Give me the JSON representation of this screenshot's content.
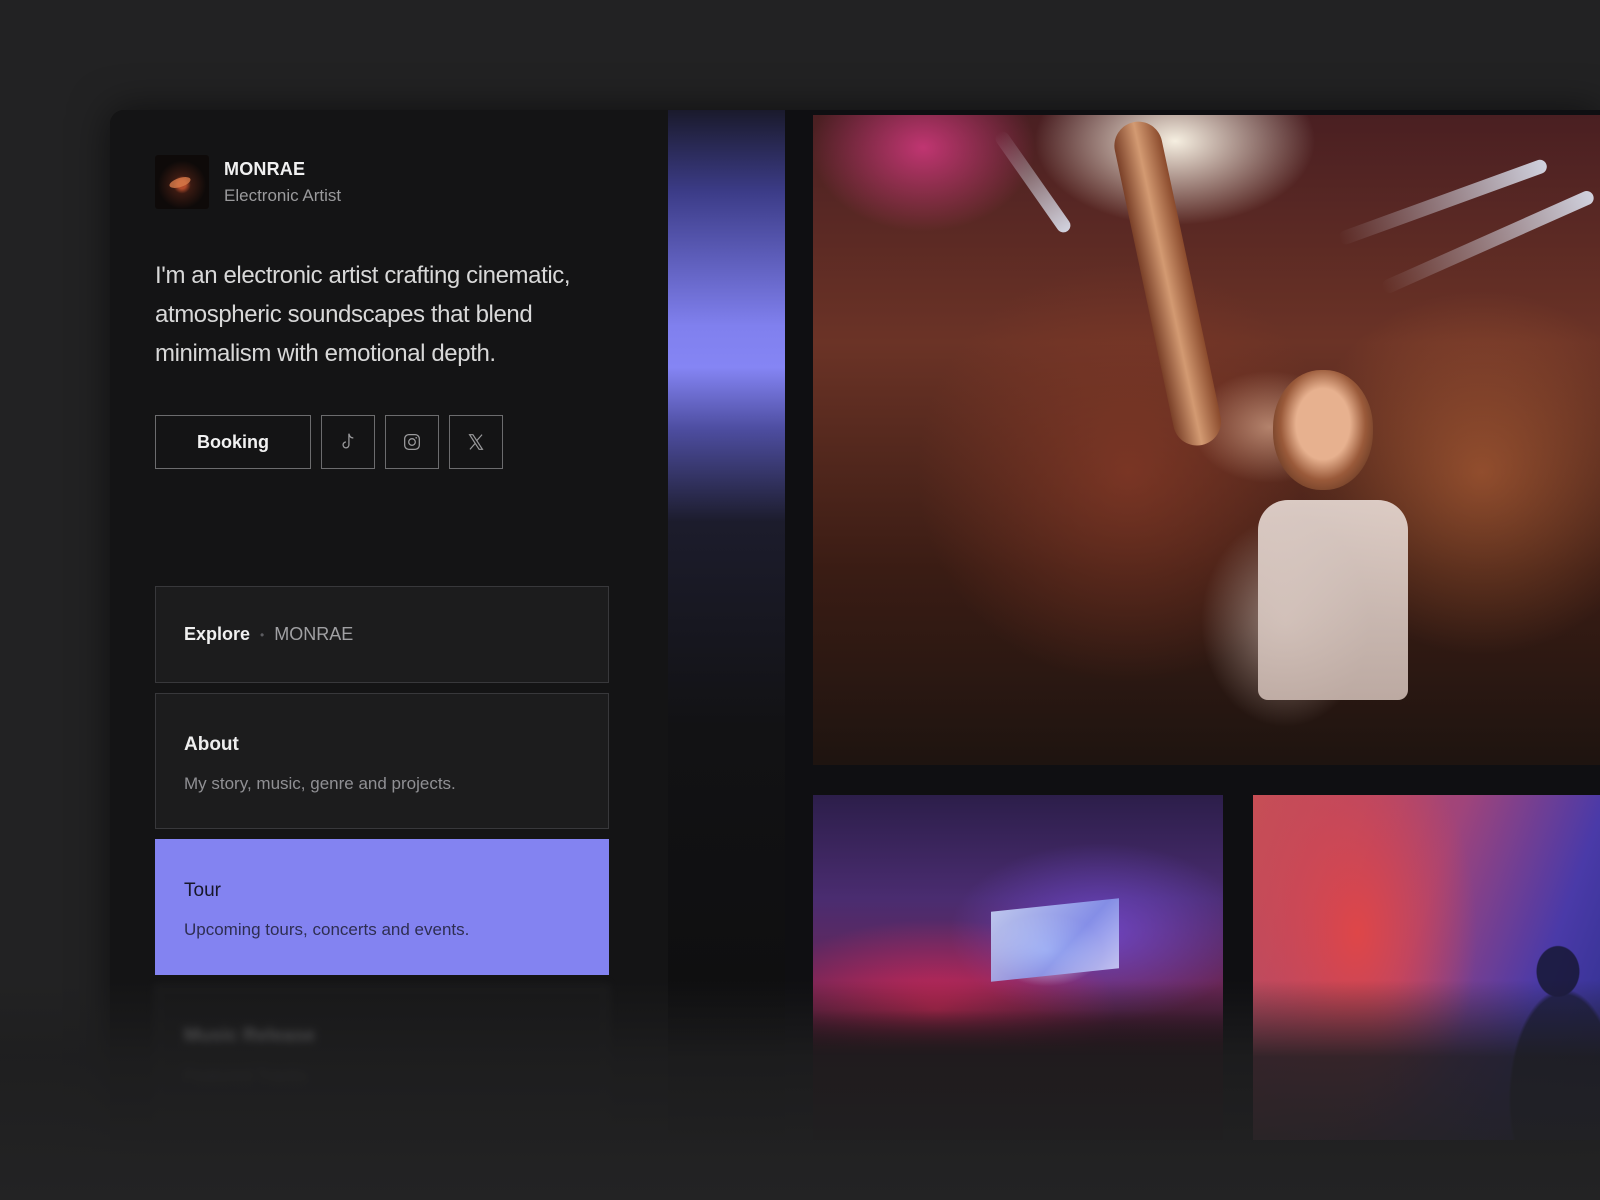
{
  "profile": {
    "name": "MONRAE",
    "role": "Electronic Artist"
  },
  "bio": "I'm an electronic artist crafting cinematic, atmospheric soundscapes that blend minimalism with emotional depth.",
  "actions": {
    "booking_label": "Booking",
    "social": [
      {
        "icon": "tiktok-icon"
      },
      {
        "icon": "instagram-icon"
      },
      {
        "icon": "x-icon"
      }
    ]
  },
  "nav": {
    "explore": {
      "label": "Explore",
      "separator": "•",
      "context": "MONRAE"
    },
    "items": [
      {
        "title": "About",
        "description": "My story, music, genre and projects.",
        "active": false
      },
      {
        "title": "Tour",
        "description": "Upcoming tours, concerts and events.",
        "active": true
      },
      {
        "title": "Music Release",
        "description": "Featured Tracks",
        "active": false
      }
    ]
  },
  "colors": {
    "accent": "#8383f1",
    "background": "#222223",
    "panel": "#141415"
  }
}
